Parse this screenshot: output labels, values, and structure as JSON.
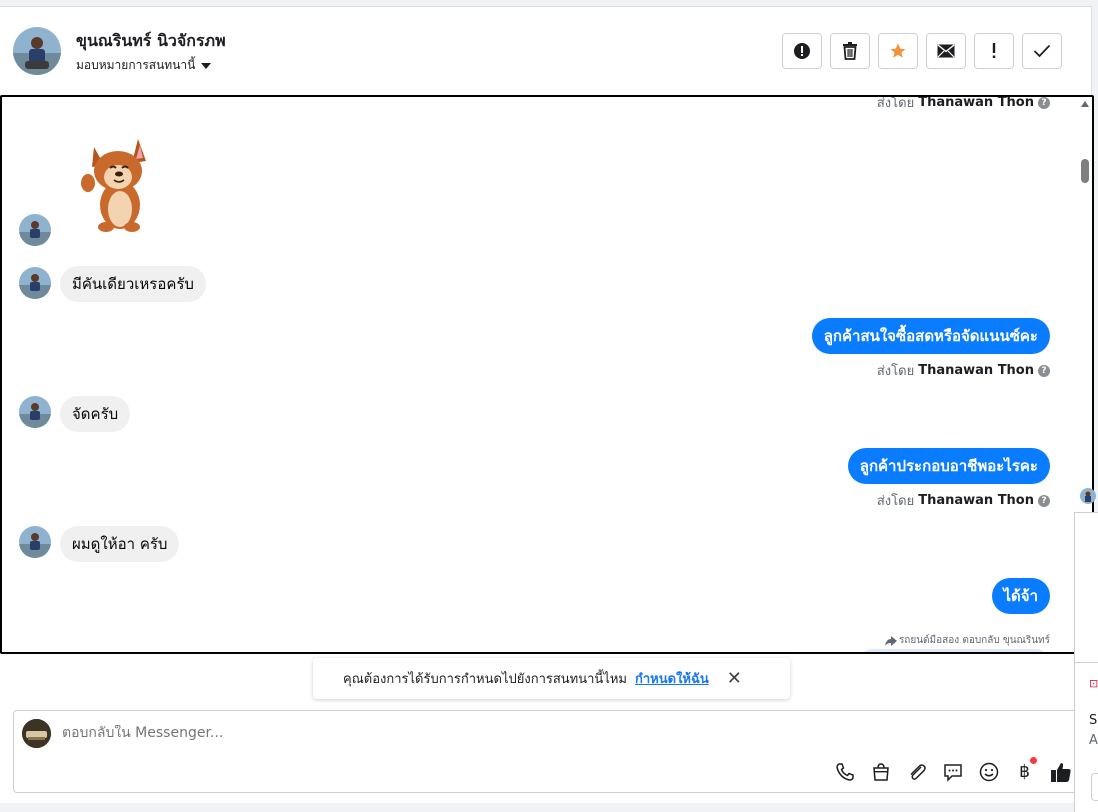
{
  "header": {
    "contact_name": "ขุนณรินทร์ นิวจักรภพ",
    "assign_label": "มอบหมายการสนทนานี้"
  },
  "actions": [
    {
      "name": "report-spam",
      "icon": "alert-circle-icon"
    },
    {
      "name": "delete",
      "icon": "trash-icon"
    },
    {
      "name": "star",
      "icon": "star-icon",
      "color": "#f2923a"
    },
    {
      "name": "mark-unread",
      "icon": "envelope-icon"
    },
    {
      "name": "follow-up",
      "icon": "exclamation-icon"
    },
    {
      "name": "mark-done",
      "icon": "check-icon"
    }
  ],
  "conversation": {
    "sent_by_prefix": "ส่งโดย",
    "sent_by_name": "Thanawan Thon",
    "sticker": "corgi-sticker",
    "messages": [
      {
        "dir": "in",
        "text": "มีคันเดียวเหรอครับ"
      },
      {
        "dir": "out",
        "text": "ลูกค้าสนใจซื้อสดหรือจัดแนนซ์คะ"
      },
      {
        "dir": "in",
        "text": "จัดครับ"
      },
      {
        "dir": "out",
        "text": "ลูกค้าประกอบอาชีพอะไรคะ"
      },
      {
        "dir": "in",
        "text": "ผมดูให้อา ครับ"
      },
      {
        "dir": "out",
        "text": "ได้จ้า"
      }
    ],
    "reply_note": "รถยนต์มือสอง ตอบกลับ ขุนณรินทร์"
  },
  "notification": {
    "text": "คุณต้องการได้รับการกำหนดไปยังการสนทนานี้ไหม",
    "link": "กำหนดให้ฉัน"
  },
  "composer": {
    "placeholder": "ตอบกลับใน Messenger..."
  },
  "peek_panel": {
    "line1": "Se",
    "line2": "A"
  },
  "colors": {
    "accent": "#0a7cff",
    "link": "#1877f2",
    "badge": "#fa383e"
  }
}
